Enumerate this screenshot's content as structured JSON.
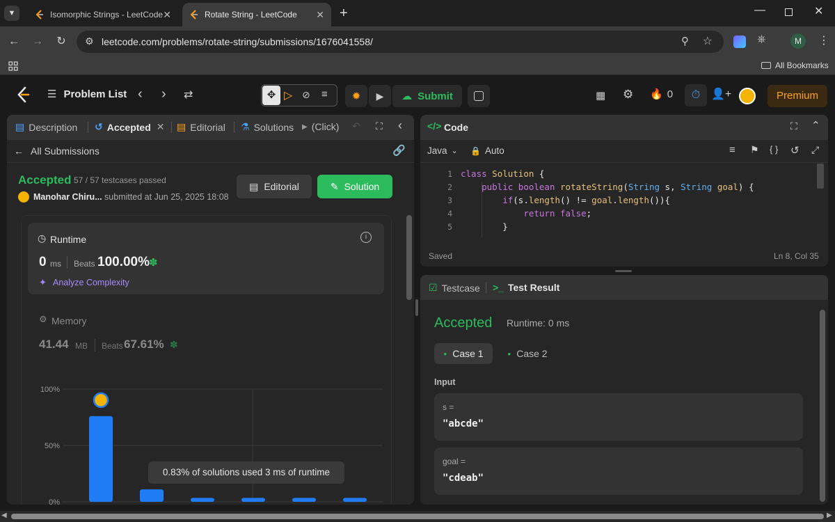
{
  "browser": {
    "tabs": [
      {
        "title": "Isomorphic Strings - LeetCode"
      },
      {
        "title": "Rotate String - LeetCode"
      }
    ],
    "url": "leetcode.com/problems/rotate-string/submissions/1676041558/",
    "bookmarks_label": "All Bookmarks",
    "profile_initial": "M"
  },
  "nav": {
    "problem_list": "Problem List",
    "submit_label": "Submit",
    "streak_count": "0",
    "premium_label": "Premium"
  },
  "left_panel": {
    "tabs": [
      "Description",
      "Accepted",
      "Editorial",
      "Solutions",
      "(Click)"
    ],
    "all_submissions": "All Submissions",
    "status": "Accepted",
    "testcases": "57 / 57 testcases passed",
    "author": "Manohar Chiru...",
    "submitted_at": "submitted at Jun 25, 2025 18:08",
    "editorial_btn": "Editorial",
    "solution_btn": "Solution",
    "runtime": {
      "label": "Runtime",
      "value": "0",
      "unit": "ms",
      "beats_label": "Beats",
      "beats": "100.00%",
      "analyze": "Analyze Complexity"
    },
    "memory": {
      "label": "Memory",
      "value": "41.44",
      "unit": "MB",
      "beats_label": "Beats",
      "beats": "67.61%"
    },
    "tooltip": "0.83% of solutions used 3 ms of runtime"
  },
  "chart_data": {
    "type": "bar",
    "ytick_labels": [
      "100%",
      "50%",
      "0%"
    ],
    "ylim": [
      0,
      100
    ],
    "values": [
      76,
      11,
      3.5,
      3.5,
      3.5,
      3.5
    ],
    "grid": true,
    "tooltip": "0.83% of solutions used 3 ms of runtime"
  },
  "code_panel": {
    "title": "Code",
    "language": "Java",
    "mode": "Auto",
    "lines": [
      {
        "n": "1",
        "code": "class Solution {"
      },
      {
        "n": "2",
        "code": "    public boolean rotateString(String s, String goal) {"
      },
      {
        "n": "3",
        "code": "        if(s.length() != goal.length()){"
      },
      {
        "n": "4",
        "code": "            return false;"
      },
      {
        "n": "5",
        "code": "        }"
      }
    ],
    "saved": "Saved",
    "cursor": "Ln 8, Col 35"
  },
  "result_panel": {
    "testcase_tab": "Testcase",
    "result_tab": "Test Result",
    "status": "Accepted",
    "runtime": "Runtime: 0 ms",
    "cases": [
      "Case 1",
      "Case 2"
    ],
    "input_label": "Input",
    "inputs": [
      {
        "name": "s =",
        "value": "\"abcde\""
      },
      {
        "name": "goal =",
        "value": "\"cdeab\""
      }
    ]
  },
  "colors": {
    "accent_green": "#2cbb5d",
    "bar_blue": "#1f7cf5",
    "panel_bg": "#262626",
    "premium_orange": "#ffa116"
  }
}
